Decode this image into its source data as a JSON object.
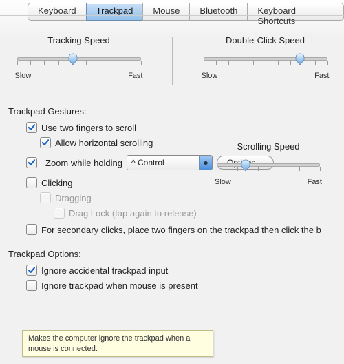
{
  "tabs": {
    "items": [
      "Keyboard",
      "Trackpad",
      "Mouse",
      "Bluetooth",
      "Keyboard Shortcuts"
    ],
    "selected_index": 1
  },
  "tracking": {
    "title": "Tracking Speed",
    "slow": "Slow",
    "fast": "Fast",
    "value_percent": 45
  },
  "doubleclick": {
    "title": "Double-Click Speed",
    "slow": "Slow",
    "fast": "Fast",
    "value_percent": 78
  },
  "gestures": {
    "title": "Trackpad Gestures:",
    "two_finger_scroll": {
      "label": "Use two fingers to scroll",
      "checked": true
    },
    "horizontal_scroll": {
      "label": "Allow horizontal scrolling",
      "checked": true
    },
    "zoom_holding": {
      "label": "Zoom while holding",
      "checked": true
    },
    "zoom_modifier": "^ Control",
    "options_button": "Options…",
    "clicking": {
      "label": "Clicking",
      "checked": false
    },
    "dragging": {
      "label": "Dragging",
      "checked": false,
      "enabled": false
    },
    "drag_lock": {
      "label": "Drag Lock (tap again to release)",
      "checked": false,
      "enabled": false
    },
    "secondary": {
      "label": "For secondary clicks, place two fingers on the trackpad then click the b",
      "checked": false
    }
  },
  "scrolling": {
    "title": "Scrolling Speed",
    "slow": "Slow",
    "fast": "Fast",
    "value_percent": 28
  },
  "options": {
    "title": "Trackpad Options:",
    "ignore_accidental": {
      "label": "Ignore accidental trackpad input",
      "checked": true
    },
    "ignore_when_mouse": {
      "label": "Ignore trackpad when mouse is present",
      "checked": false
    }
  },
  "tooltip": "Makes the computer ignore the trackpad when a mouse is connected."
}
